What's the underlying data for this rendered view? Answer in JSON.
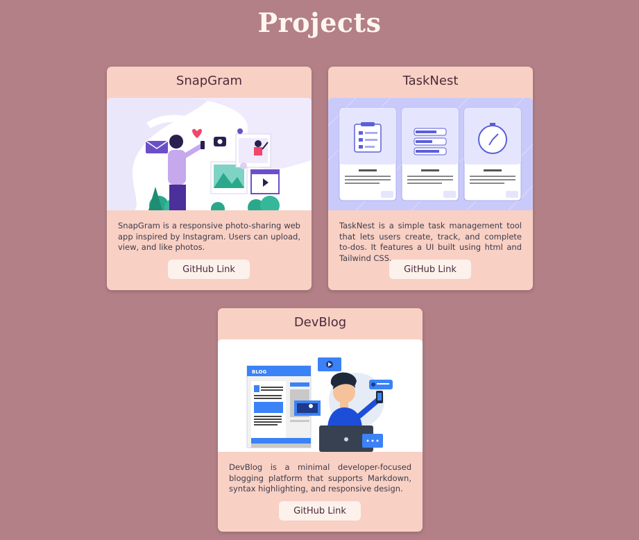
{
  "page": {
    "title": "Projects"
  },
  "projects": [
    {
      "title": "SnapGram",
      "description": "SnapGram is a responsive photo-sharing web app inspired by Instagram. Users can upload, view, and like photos.",
      "button_label": "GitHub Link",
      "image": "photo-sharing-illustration"
    },
    {
      "title": "TaskNest",
      "description": "TaskNest is a simple task management tool that lets users create, track, and complete to-dos. It features a UI built using html and Tailwind CSS.",
      "button_label": "GitHub Link",
      "image": "task-app-screens-illustration"
    },
    {
      "title": "DevBlog",
      "description": "DevBlog is a minimal developer-focused blogging platform that supports Markdown, syntax highlighting, and responsive design.",
      "button_label": "GitHub Link",
      "image": "blogging-developer-illustration",
      "blog_tag": "BLOG"
    }
  ],
  "colors": {
    "background": "#b38087",
    "card": "#f9d0c4",
    "button": "#fdf1ec",
    "title_text": "#fff7ee"
  }
}
